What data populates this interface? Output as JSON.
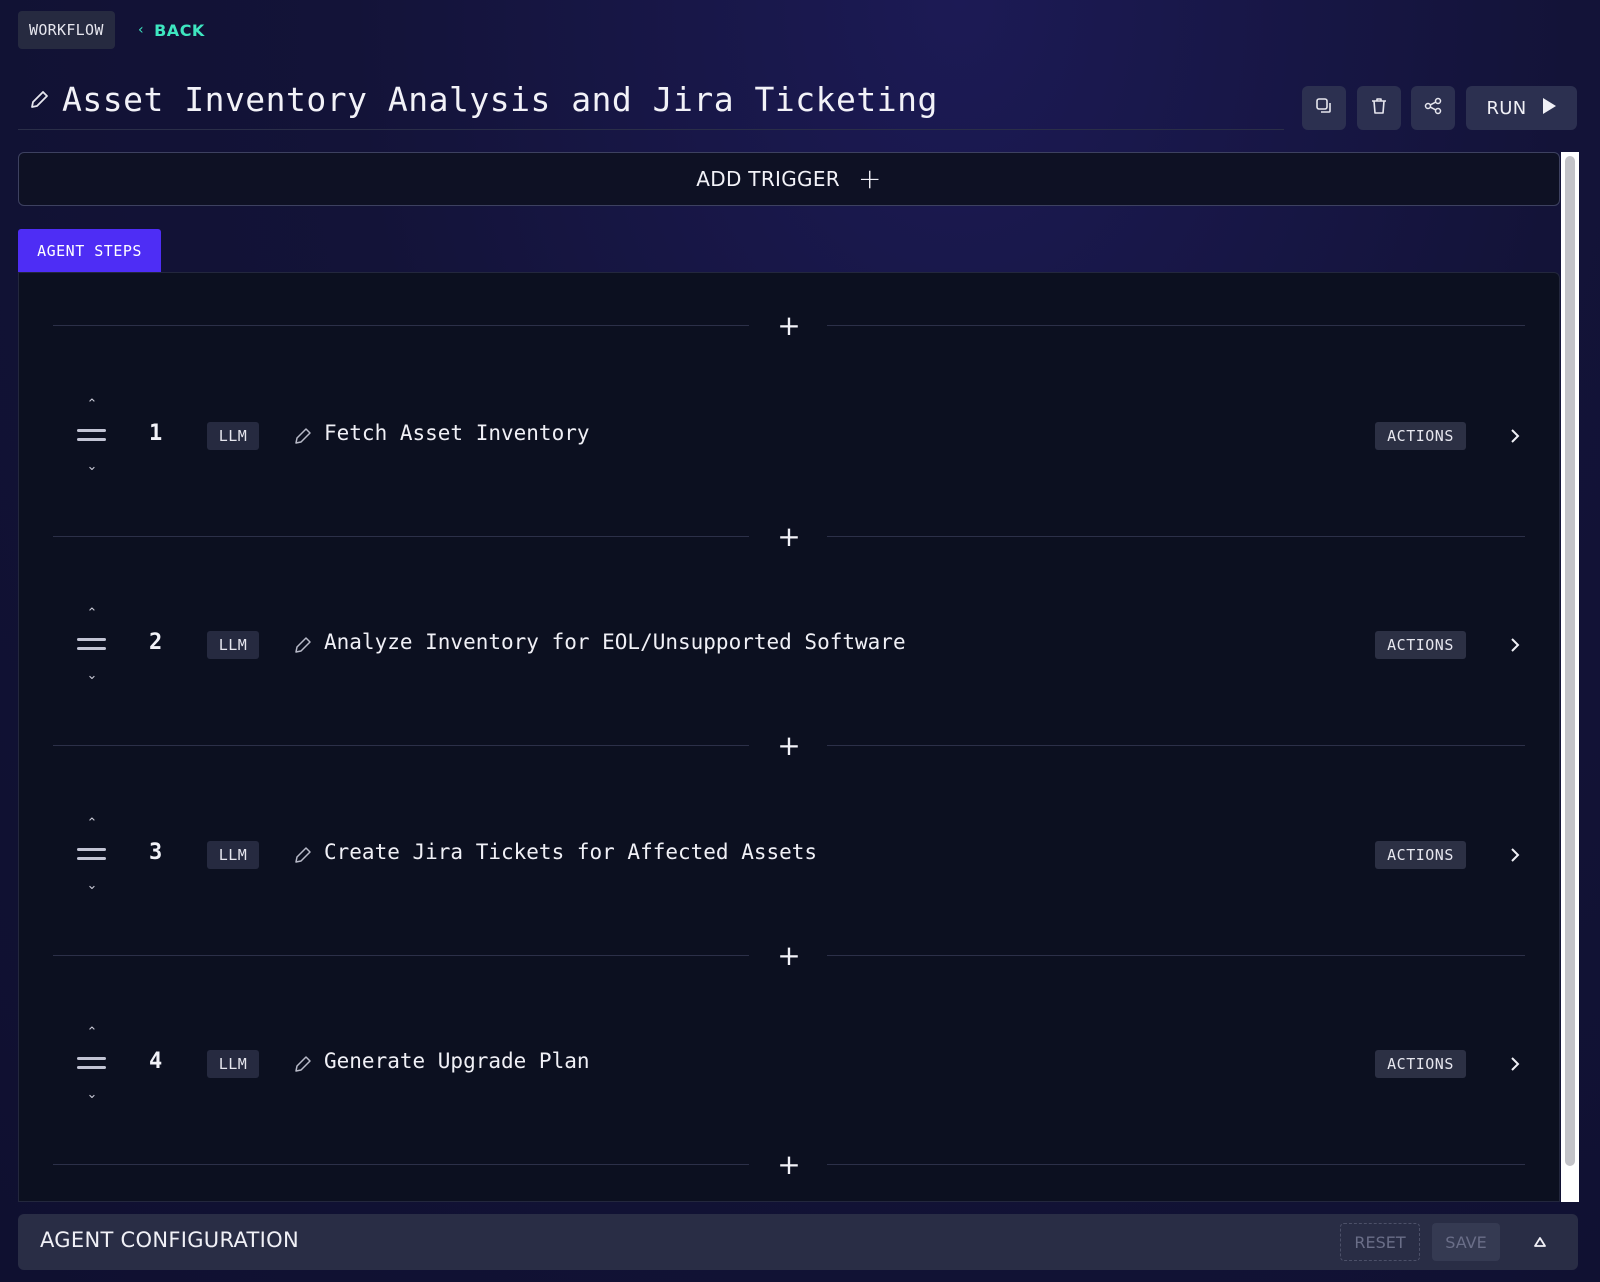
{
  "header": {
    "section_label": "WORKFLOW",
    "back_label": "BACK",
    "title": "Asset Inventory Analysis and Jira Ticketing"
  },
  "toolbar": {
    "run_label": "RUN",
    "icons": [
      "copy-icon",
      "trash-icon",
      "share-icon",
      "play-icon"
    ]
  },
  "trigger": {
    "add_label": "ADD TRIGGER"
  },
  "tabs": [
    {
      "label": "AGENT STEPS",
      "active": true
    }
  ],
  "steps": [
    {
      "number": "1",
      "type": "LLM",
      "name": "Fetch Asset Inventory",
      "actions_label": "ACTIONS"
    },
    {
      "number": "2",
      "type": "LLM",
      "name": "Analyze Inventory for EOL/Unsupported Software",
      "actions_label": "ACTIONS"
    },
    {
      "number": "3",
      "type": "LLM",
      "name": "Create Jira Tickets for Affected Assets",
      "actions_label": "ACTIONS"
    },
    {
      "number": "4",
      "type": "LLM",
      "name": "Generate Upgrade Plan",
      "actions_label": "ACTIONS"
    }
  ],
  "config": {
    "title": "AGENT CONFIGURATION",
    "reset_label": "RESET",
    "save_label": "SAVE"
  },
  "colors": {
    "accent": "#4e2df5",
    "back_link": "#3ee6c0",
    "background": "#131338",
    "panel": "#0c1020"
  }
}
